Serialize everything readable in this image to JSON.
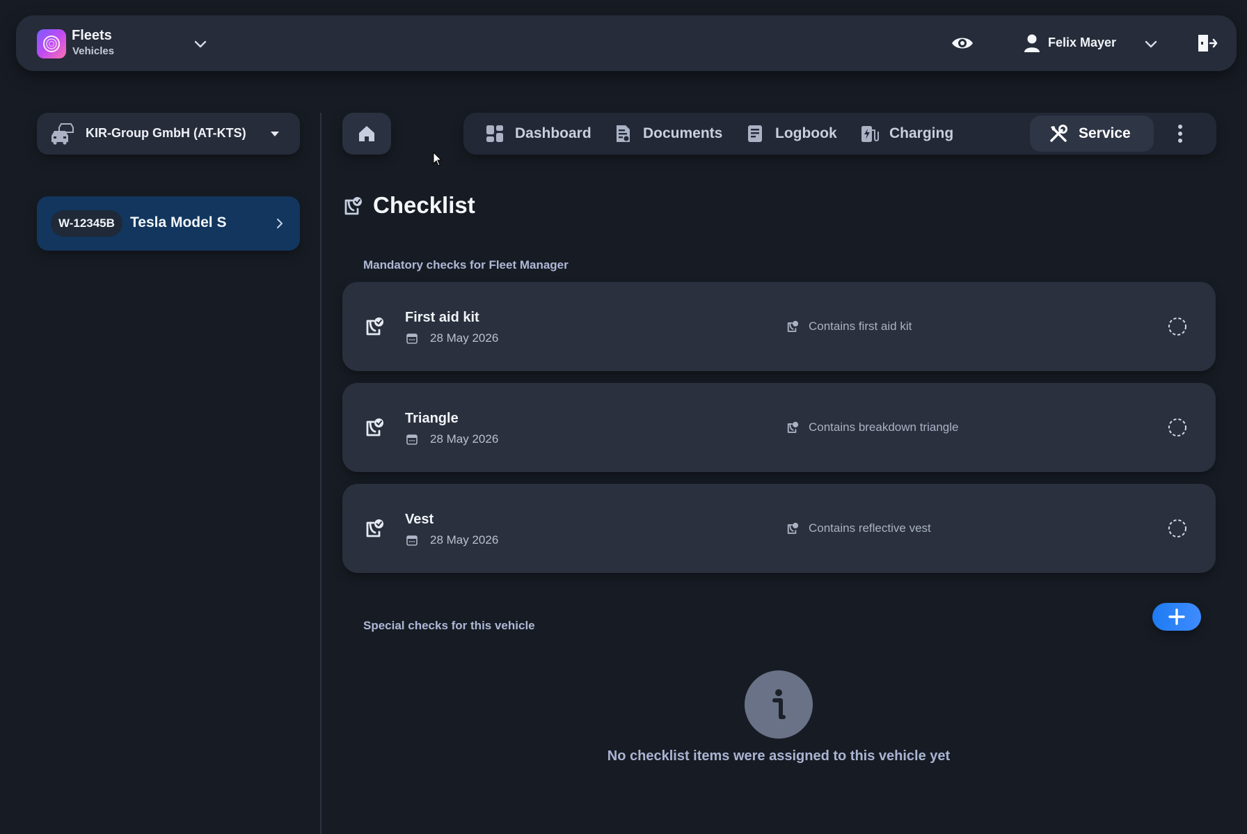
{
  "app": {
    "title": "Fleets",
    "subtitle": "Vehicles",
    "logo_icon": "fleets-logo-icon"
  },
  "header": {
    "user_name": "Felix Mayer",
    "icons": [
      "eye-icon",
      "user-icon",
      "chevron-down-icon",
      "logout-icon"
    ]
  },
  "sidebar": {
    "organization": "KIR-Group GmbH (AT-KTS)",
    "vehicles": [
      {
        "plate": "W-12345B",
        "name": "Tesla Model S",
        "selected": true
      }
    ]
  },
  "nav": {
    "items": [
      {
        "label": "Dashboard",
        "icon": "dashboard-icon",
        "active": false
      },
      {
        "label": "Documents",
        "icon": "documents-icon",
        "active": false
      },
      {
        "label": "Logbook",
        "icon": "logbook-icon",
        "active": false
      },
      {
        "label": "Charging",
        "icon": "charging-icon",
        "active": false
      },
      {
        "label": "Service",
        "icon": "service-tools-icon",
        "active": true
      }
    ],
    "more_icon": "more-vertical-icon",
    "home_icon": "home-icon"
  },
  "page": {
    "title": "Checklist",
    "mandatory_section_title": "Mandatory checks for Fleet Manager",
    "special_section_title": "Special checks for this vehicle",
    "empty_message": "No checklist items were assigned to this vehicle yet"
  },
  "checks": [
    {
      "title": "First aid kit",
      "date": "28 May 2026",
      "description": "Contains first aid kit",
      "status": "pending"
    },
    {
      "title": "Triangle",
      "date": "28 May 2026",
      "description": "Contains breakdown triangle",
      "status": "pending"
    },
    {
      "title": "Vest",
      "date": "28 May 2026",
      "description": "Contains reflective vest",
      "status": "pending"
    }
  ],
  "colors": {
    "background": "#171c24",
    "card": "#2a303d",
    "accent": "#2f86f6",
    "selected_vehicle": "#12365e",
    "section_label": "#aeb8d6"
  }
}
